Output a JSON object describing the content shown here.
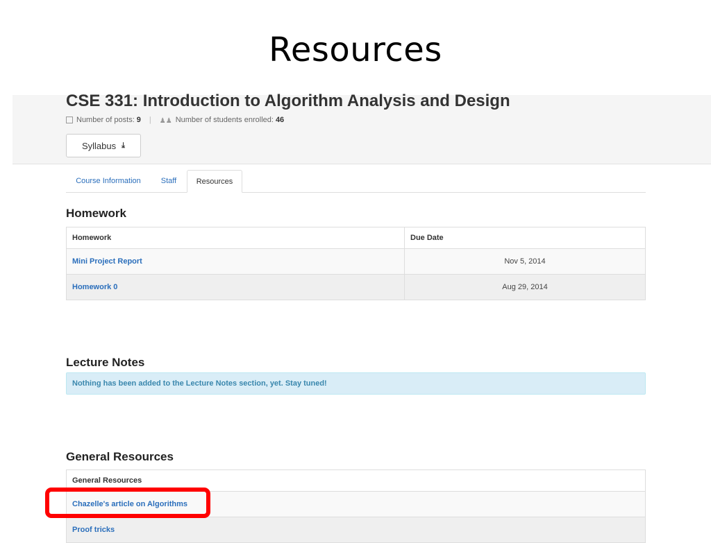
{
  "slide": {
    "title": "Resources"
  },
  "course": {
    "title": "CSE 331: Introduction to Algorithm Analysis and Design",
    "posts_label": "Number of posts:",
    "posts_count": "9",
    "students_label": "Number of students enrolled:",
    "students_count": "46",
    "syllabus_label": "Syllabus",
    "download_icon": "⤓"
  },
  "tabs": [
    {
      "label": "Course Information",
      "active": false
    },
    {
      "label": "Staff",
      "active": false
    },
    {
      "label": "Resources",
      "active": true
    }
  ],
  "homework": {
    "heading": "Homework",
    "columns": [
      "Homework",
      "Due Date"
    ],
    "rows": [
      {
        "name": "Mini Project Report",
        "due": "Nov 5, 2014"
      },
      {
        "name": "Homework 0",
        "due": "Aug 29, 2014"
      }
    ]
  },
  "lecture_notes": {
    "heading": "Lecture Notes",
    "message": "Nothing has been added to the Lecture Notes section, yet. Stay tuned!"
  },
  "general_resources": {
    "heading": "General Resources",
    "columns": [
      "General Resources"
    ],
    "rows": [
      {
        "name": "Chazelle's article on Algorithms"
      },
      {
        "name": "Proof tricks"
      }
    ]
  },
  "colors": {
    "link": "#2a6ebb",
    "info_bg": "#d9edf7",
    "info_text": "#3a87ad",
    "highlight": "#ff0000",
    "header_bg": "#f5f5f5"
  },
  "icons": {
    "posts": "edit-icon",
    "students": "users-icon",
    "syllabus": "download-icon"
  }
}
